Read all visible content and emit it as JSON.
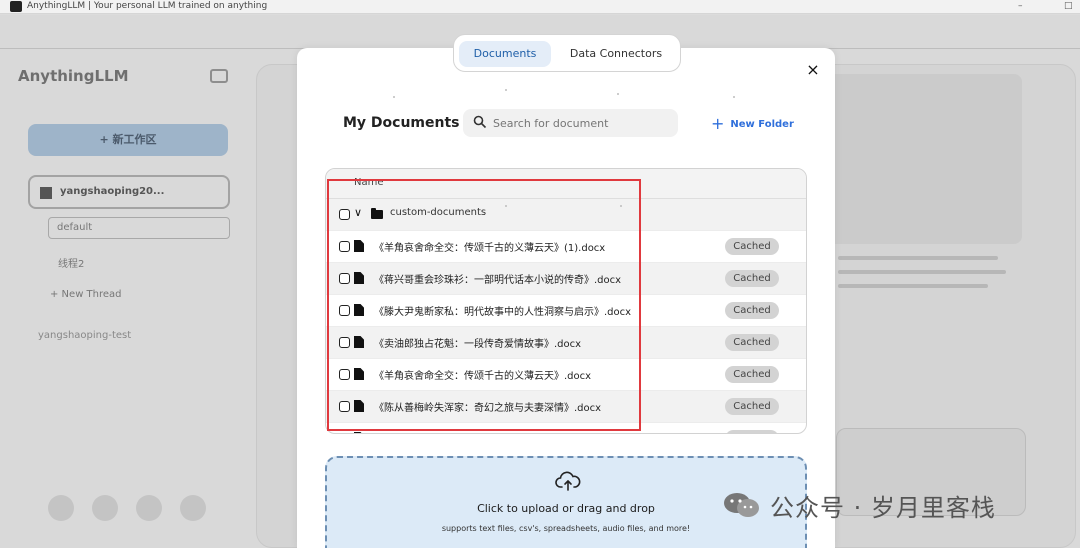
{
  "window": {
    "title": "AnythingLLM | Your personal LLM trained on anything",
    "minimize": "–",
    "maximize": "□"
  },
  "background": {
    "brand": "AnythingLLM",
    "new_workspace": "+ 新工作区",
    "workspace_1": "yangshaoping20...",
    "thread_default": "default",
    "thread_2": "线程2",
    "new_thread": "+ New Thread",
    "workspace_2": "yangshaoping-test"
  },
  "tabs": {
    "documents": "Documents",
    "data_connectors": "Data Connectors"
  },
  "modal": {
    "close": "×",
    "title": "My Documents",
    "search_placeholder": "Search for document",
    "new_folder": "New Folder"
  },
  "table": {
    "header": "Name",
    "folder": "custom-documents",
    "rows": [
      {
        "name": "《羊角哀舍命全交：传颂千古的义薄云天》(1).docx",
        "status": "Cached"
      },
      {
        "name": "《蒋兴哥重会珍珠衫：一部明代话本小说的传奇》.docx",
        "status": "Cached"
      },
      {
        "name": "《滕大尹鬼断家私：明代故事中的人性洞察与启示》.docx",
        "status": "Cached"
      },
      {
        "name": "《卖油郎独占花魁：一段传奇爱情故事》.docx",
        "status": "Cached"
      },
      {
        "name": "《羊角哀舍命全交：传颂千古的义薄云天》.docx",
        "status": "Cached"
      },
      {
        "name": "《陈从善梅岭失浑家：奇幻之旅与夫妻深情》.docx",
        "status": "Cached"
      }
    ]
  },
  "upload": {
    "main": "Click to upload or drag and drop",
    "sub": "supports text files, csv's, spreadsheets, audio files, and more!"
  },
  "watermark": {
    "text": "公众号 · 岁月里客栈"
  },
  "colors": {
    "accent": "#2f6fdb",
    "highlight_box": "#e0393e",
    "upload_bg": "#dceaf7"
  }
}
